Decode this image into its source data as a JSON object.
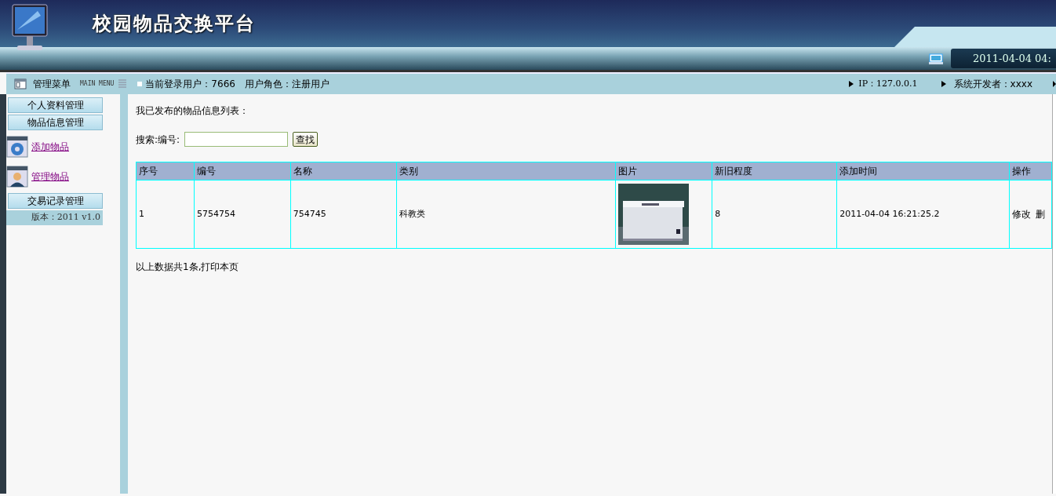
{
  "header": {
    "title": "校园物品交换平台",
    "datetime": "2011-04-04 04:"
  },
  "infobar": {
    "menu_title": "管理菜单",
    "menu_subtitle": "MAIN MENU",
    "user": "当前登录用户：7666",
    "role": "用户角色：注册用户",
    "ip": "IP：127.0.0.1",
    "developer": "系统开发者：xxxx"
  },
  "sidebar": {
    "items": [
      {
        "kind": "section",
        "label": "个人资料管理"
      },
      {
        "kind": "section",
        "label": "物品信息管理"
      },
      {
        "kind": "link",
        "label": "添加物品"
      },
      {
        "kind": "link",
        "label": "管理物品"
      },
      {
        "kind": "section",
        "label": "交易记录管理"
      }
    ],
    "version": "版本：2011 v1.0"
  },
  "main": {
    "heading": "我已发布的物品信息列表：",
    "search": {
      "label": "搜索:编号:",
      "button": "查找"
    },
    "table": {
      "columns": [
        "序号",
        "编号",
        "名称",
        "类别",
        "图片",
        "新旧程度",
        "添加时间",
        "操作"
      ],
      "rows": [
        {
          "cells": [
            {
              "kind": "text",
              "text": "1"
            },
            {
              "kind": "text",
              "text": "5754754"
            },
            {
              "kind": "text",
              "text": "754745"
            },
            {
              "kind": "text",
              "text": "科教类"
            },
            {
              "kind": "picture"
            },
            {
              "kind": "text",
              "text": "8"
            },
            {
              "kind": "text",
              "text": "2011-04-04 16:21:25.2"
            },
            {
              "kind": "actions",
              "links": [
                "修改",
                "删"
              ]
            }
          ]
        }
      ]
    },
    "footer": "以上数据共1条,打印本页"
  }
}
